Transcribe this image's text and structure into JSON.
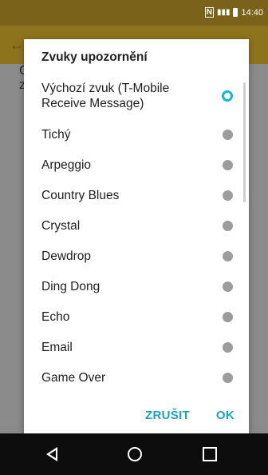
{
  "status_bar": {
    "time": "14:40"
  },
  "dialog": {
    "title": "Zvuky upozornění",
    "options": [
      {
        "label": "Výchozí zvuk (T-Mobile Receive Message)",
        "selected": true
      },
      {
        "label": "Tichý",
        "selected": false
      },
      {
        "label": "Arpeggio",
        "selected": false
      },
      {
        "label": "Country Blues",
        "selected": false
      },
      {
        "label": "Crystal",
        "selected": false
      },
      {
        "label": "Dewdrop",
        "selected": false
      },
      {
        "label": "Ding Dong",
        "selected": false
      },
      {
        "label": "Echo",
        "selected": false
      },
      {
        "label": "Email",
        "selected": false
      },
      {
        "label": "Game Over",
        "selected": false
      }
    ],
    "cancel_label": "ZRUŠIT",
    "ok_label": "OK"
  },
  "colors": {
    "accent": "#18b6d4",
    "status_bar": "#7a6318",
    "app_bar": "#8d741c"
  },
  "background": {
    "fragment_1": "C",
    "fragment_2": "z"
  }
}
